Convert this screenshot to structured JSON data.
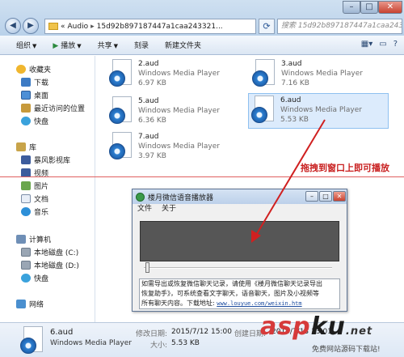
{
  "window": {
    "address_path": [
      "Audio",
      "15d92b897187447a1caa243321..."
    ],
    "address_prefix": "«",
    "search_placeholder": "搜索 15d92b897187447a1caa2433..."
  },
  "toolbar": {
    "organize": "组织",
    "play": "播放",
    "share": "共享",
    "burn": "刻录",
    "new_folder": "新建文件夹"
  },
  "sidebar": {
    "favorites": "收藏夹",
    "fav_items": [
      "下载",
      "桌面",
      "最近访问的位置",
      "快盘"
    ],
    "library": "库",
    "lib_items": [
      "暴风影视库",
      "视频",
      "图片",
      "文档",
      "音乐"
    ],
    "computer": "计算机",
    "pc_items": [
      "本地磁盘 (C:)",
      "本地磁盘 (D:)",
      "快盘"
    ],
    "network": "网络"
  },
  "files": [
    {
      "name": "2.aud",
      "type": "Windows Media Player",
      "size": "6.97 KB",
      "selected": false
    },
    {
      "name": "3.aud",
      "type": "Windows Media Player",
      "size": "7.16 KB",
      "selected": false
    },
    {
      "name": "5.aud",
      "type": "Windows Media Player",
      "size": "6.36 KB",
      "selected": false
    },
    {
      "name": "6.aud",
      "type": "Windows Media Player",
      "size": "5.53 KB",
      "selected": true
    },
    {
      "name": "7.aud",
      "type": "Windows Media Player",
      "size": "3.97 KB",
      "selected": false
    }
  ],
  "annotation": {
    "callout": "拖拽到窗口上即可播放",
    "accent": "#c81e1e"
  },
  "player": {
    "title": "楼月微信语音播放器",
    "menu": [
      "文件",
      "关于"
    ],
    "info_line1": "如需导出或恢复微信聊天记录，请使用《楼月微信聊天记录导出",
    "info_line2": "恢复助手》，可系统查看文字聊天，语音聊天，图片及小视频等",
    "info_line3_prefix": "所有聊天内容。下载地址:",
    "info_link": "www.louyue.com/weixin.htm"
  },
  "details": {
    "name": "6.aud",
    "type": "Windows Media Player",
    "modified_label": "修改日期:",
    "modified_value": "2015/7/12 15:00",
    "size_label": "大小:",
    "size_value": "5.53 KB",
    "created_label": "创建日期:",
    "created_value": "2015/7/13 13:01"
  },
  "watermark": {
    "brand_a": "asp",
    "brand_b": "ku",
    "brand_c": ".net",
    "sub": "免费网站源码下载站!"
  }
}
